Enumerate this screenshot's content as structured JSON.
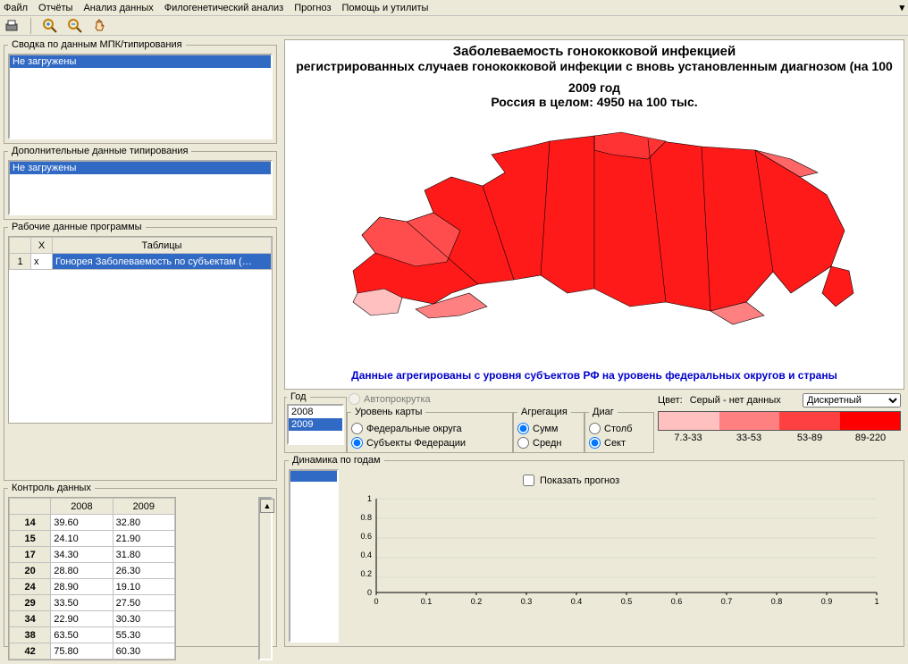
{
  "menu": {
    "file": "Файл",
    "reports": "Отчёты",
    "analysis": "Анализ данных",
    "phylo": "Филогенетический анализ",
    "prognosis": "Прогноз",
    "help": "Помощь и утилиты"
  },
  "panels": {
    "summary": {
      "title": "Сводка по данным МПК/типирования",
      "content": "Не загружены"
    },
    "additional": {
      "title": "Дополнительные данные типирования",
      "content": "Не загружены"
    },
    "prog": {
      "title": "Рабочие данные программы",
      "col_x": "X",
      "col_tables": "Таблицы",
      "row_num": "1",
      "row_x": "x",
      "row_table": "Гонорея Заболеваемость по субъектам (…"
    },
    "control": {
      "title": "Контроль данных",
      "years": [
        "2008",
        "2009"
      ],
      "rows": [
        {
          "id": "14",
          "v": [
            "39.60",
            "32.80"
          ]
        },
        {
          "id": "15",
          "v": [
            "24.10",
            "21.90"
          ]
        },
        {
          "id": "17",
          "v": [
            "34.30",
            "31.80"
          ]
        },
        {
          "id": "20",
          "v": [
            "28.80",
            "26.30"
          ]
        },
        {
          "id": "24",
          "v": [
            "28.90",
            "19.10"
          ]
        },
        {
          "id": "29",
          "v": [
            "33.50",
            "27.50"
          ]
        },
        {
          "id": "34",
          "v": [
            "22.90",
            "30.30"
          ]
        },
        {
          "id": "38",
          "v": [
            "63.50",
            "55.30"
          ]
        },
        {
          "id": "42",
          "v": [
            "75.80",
            "60.30"
          ]
        }
      ]
    }
  },
  "map": {
    "title": "Заболеваемость гонококковой инфекцией",
    "subtitle": "регистрированных случаев гонококковой инфекции с вновь установленным диагнозом (на 100",
    "year_line": "2009 год",
    "total_line": "Россия в целом: 4950 на 100 тыс.",
    "footnote": "Данные агрегированы с уровня субъектов РФ на уровень федеральных округов и страны"
  },
  "controls": {
    "year_label": "Год",
    "years": [
      "2008",
      "2009"
    ],
    "selected_year": "2009",
    "autoscroll": "Автопрокрутка",
    "level": {
      "title": "Уровень карты",
      "opt_fed": "Федеральные округа",
      "opt_sub": "Субъекты Федерации"
    },
    "agg": {
      "title": "Агрегация",
      "opt_sum": "Сумм",
      "opt_avg": "Средн"
    },
    "diag": {
      "title": "Диаг",
      "opt_col": "Столб",
      "opt_sect": "Сект"
    },
    "color": {
      "label": "Цвет:",
      "nodata": "Серый - нет данных",
      "mode": "Дискретный",
      "legend": [
        "7.3-33",
        "33-53",
        "53-89",
        "89-220"
      ]
    }
  },
  "dynamics": {
    "title": "Динамика по годам",
    "show_prognosis": "Показать прогноз"
  },
  "chart_data": {
    "type": "line",
    "title": "Динамика по годам",
    "x": [
      0,
      0.1,
      0.2,
      0.3,
      0.4,
      0.5,
      0.6,
      0.7,
      0.8,
      0.9,
      1
    ],
    "y_ticks": [
      0,
      0.2,
      0.4,
      0.6,
      0.8,
      1
    ],
    "series": [],
    "xlim": [
      0,
      1
    ],
    "ylim": [
      0,
      1
    ]
  }
}
